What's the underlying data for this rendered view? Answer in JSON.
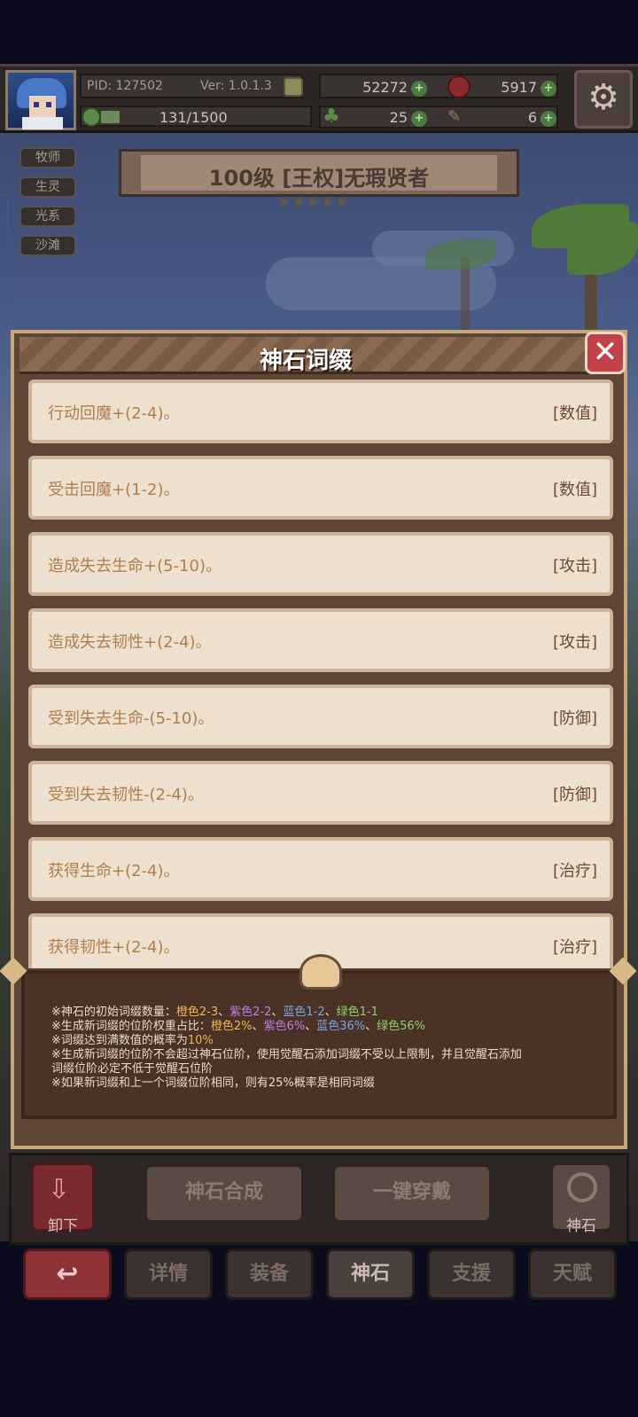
{
  "topbar": {
    "pid": "PID: 127502",
    "version": "Ver: 1.0.1.3",
    "xp": "131/1500",
    "xp_fraction": 0.087,
    "currency_1": "52272",
    "currency_2": "5917",
    "currency_3": "25",
    "currency_4": "6"
  },
  "tags": [
    "牧师",
    "生灵",
    "光系",
    "沙滩"
  ],
  "hero": {
    "title": "100级 [王权]无瑕贤者",
    "stars": "★★★★★"
  },
  "modal": {
    "title": "神石词缀",
    "close_label": "✕",
    "affixes": [
      {
        "text": "行动回魔+(2-4)。",
        "category": "[数值]"
      },
      {
        "text": "受击回魔+(1-2)。",
        "category": "[数值]"
      },
      {
        "text": "造成失去生命+(5-10)。",
        "category": "[攻击]"
      },
      {
        "text": "造成失去韧性+(2-4)。",
        "category": "[攻击]"
      },
      {
        "text": "受到失去生命-(5-10)。",
        "category": "[防御]"
      },
      {
        "text": "受到失去韧性-(2-4)。",
        "category": "[防御]"
      },
      {
        "text": "获得生命+(2-4)。",
        "category": "[治疗]"
      },
      {
        "text": "获得韧性+(2-4)。",
        "category": "[治疗]"
      }
    ],
    "notes": {
      "line1_prefix": "※神石的初始词缀数量：",
      "line1_orange": "橙色2-3",
      "line1_purple": "紫色2-2",
      "line1_blue": "蓝色1-2",
      "line1_green": "绿色1-1",
      "line2_prefix": "※生成新词缀的位阶权重占比：",
      "line2_orange": "橙色2%",
      "line2_purple": "紫色6%",
      "line2_blue": "蓝色36%",
      "line2_green": "绿色56%",
      "line3_prefix": "※词缀达到满数值的概率为",
      "line3_value": "10%",
      "line4": "※生成新词缀的位阶不会超过神石位阶，使用觉醒石添加词缀不受以上限制，并且觉醒石添加",
      "line5": "词缀位阶必定不低于觉醒石位阶",
      "line6": "※如果新词缀和上一个词缀位阶相同，则有25%概率是相同词缀",
      "separator": "、"
    }
  },
  "actions": {
    "unequip": "卸下",
    "synthesize": "神石合成",
    "equip_all": "一键穿戴",
    "stone": "神石"
  },
  "tabs": {
    "back": "↩",
    "details": "详情",
    "equipment": "装备",
    "stone": "神石",
    "support": "支援",
    "talent": "天赋"
  },
  "colors": {
    "orange": "#f2b34a",
    "purple": "#c27ae6",
    "blue": "#7aa6e6",
    "green": "#8ed06a",
    "close_red": "#c2424a"
  }
}
